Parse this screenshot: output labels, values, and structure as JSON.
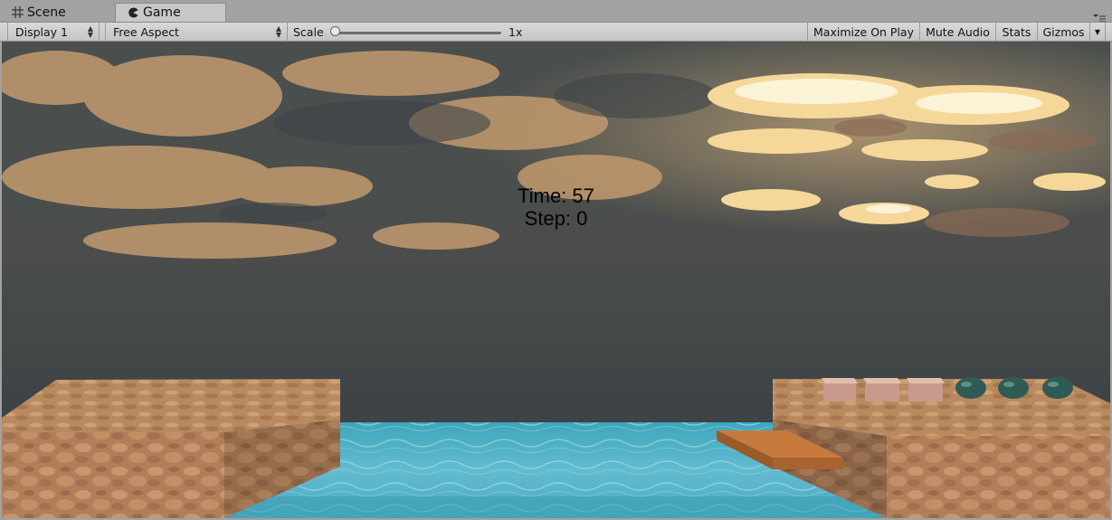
{
  "tabs": [
    {
      "label": "Scene",
      "icon": "grid-icon",
      "active": false
    },
    {
      "label": "Game",
      "icon": "pacman-icon",
      "active": true
    }
  ],
  "toolbar": {
    "display": "Display 1",
    "aspect": "Free Aspect",
    "scale_label": "Scale",
    "scale_value": "1x",
    "scale_level": 0,
    "maximize_on_play": "Maximize On Play",
    "mute_audio": "Mute Audio",
    "stats": "Stats",
    "gizmos": "Gizmos"
  },
  "hud": {
    "time": "Time: 57",
    "step": "Step: 0"
  },
  "scene": {
    "sky_colors": {
      "cloud": "#c29a6e",
      "dark": "#3d4548",
      "sunset": "#f6d79a"
    },
    "water_color": "#5cb7c9",
    "rock_color": "#b07f5a",
    "plank_color": "#c77a3e",
    "left_platform": true,
    "right_platform": true,
    "boxes": 3,
    "eggs": 3
  }
}
